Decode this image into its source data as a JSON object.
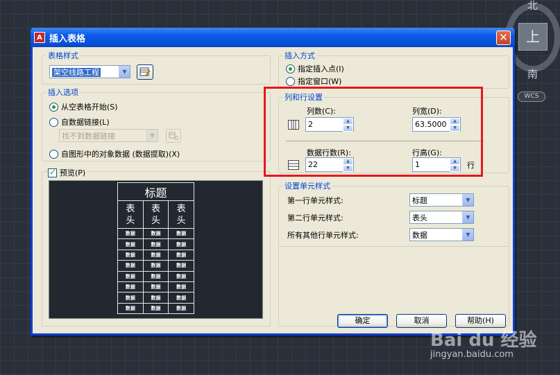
{
  "viewcube": {
    "north": "北",
    "top": "上",
    "south": "南",
    "wcs": "WCS"
  },
  "dialog": {
    "title": "插入表格",
    "close": "✕",
    "table_style": {
      "legend": "表格样式",
      "value": "架空线路工程"
    },
    "insert_options": {
      "legend": "插入选项",
      "from_empty": "从空表格开始(S)",
      "from_data_link": "自数据链接(L)",
      "data_link_placeholder": "找不到数据链接",
      "from_drawing": "自图形中的对象数据 (数据提取)(X)"
    },
    "preview": {
      "label": "预览(P)",
      "title": "标题",
      "headers": [
        "表\n头",
        "表\n头",
        "表\n头"
      ],
      "data_cell": "数据",
      "data_rows": 8
    },
    "insert_method": {
      "legend": "插入方式",
      "specify_point": "指定插入点(I)",
      "specify_window": "指定窗口(W)"
    },
    "col_row": {
      "legend": "列和行设置",
      "columns_label": "列数(C):",
      "columns_value": "2",
      "col_width_label": "列宽(D):",
      "col_width_value": "63.5000",
      "data_rows_label": "数据行数(R):",
      "data_rows_value": "22",
      "row_height_label": "行高(G):",
      "row_height_value": "1",
      "row_unit": "行"
    },
    "cell_styles": {
      "legend": "设置单元样式",
      "first_row_label": "第一行单元样式:",
      "first_row_value": "标题",
      "second_row_label": "第二行单元样式:",
      "second_row_value": "表头",
      "other_rows_label": "所有其他行单元样式:",
      "other_rows_value": "数据"
    },
    "buttons": {
      "ok": "确定",
      "cancel": "取消",
      "help": "帮助(H)"
    }
  },
  "watermark": {
    "logo": "Bai du 经验",
    "url": "jingyan.baidu.com"
  },
  "colors": {
    "accent": "#0046d5",
    "title_bar": "#0a4ed4",
    "highlight_box": "#e8161f",
    "radio_dot": "#21a121"
  }
}
